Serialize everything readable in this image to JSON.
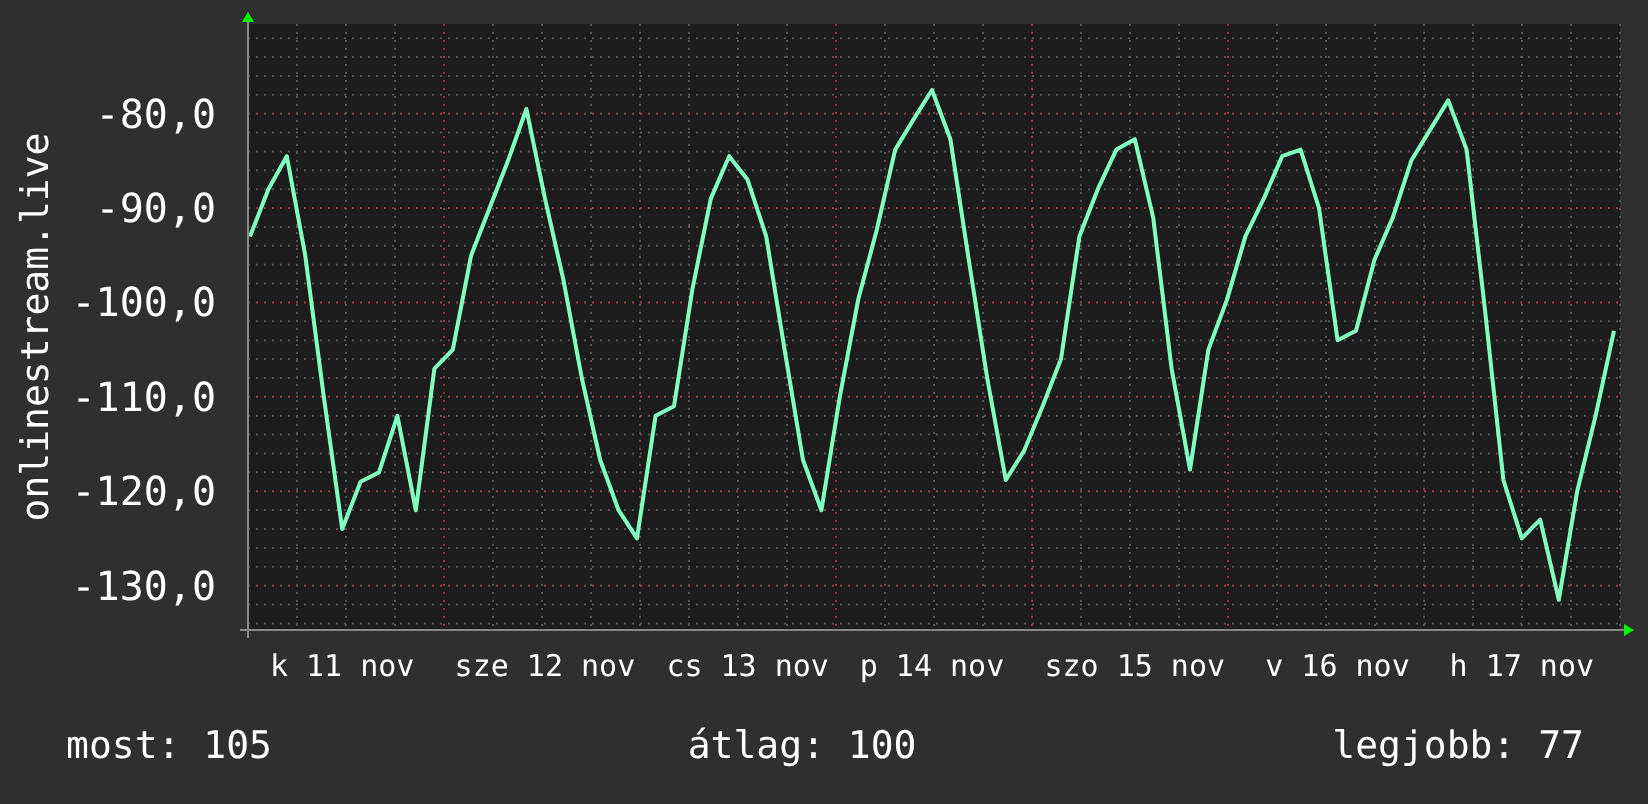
{
  "chart": {
    "chart_data": {
      "type": "line",
      "ylabel": "onlinestream.live",
      "ylim": [
        -134.7,
        -70.5
      ],
      "yticks": [
        {
          "value": -80,
          "label": "-80,0"
        },
        {
          "value": -90,
          "label": "-90,0"
        },
        {
          "value": -100,
          "label": "-100,0"
        },
        {
          "value": -110,
          "label": "-110,0"
        },
        {
          "value": -120,
          "label": "-120,0"
        },
        {
          "value": -130,
          "label": "-130,0"
        }
      ],
      "grid": true,
      "categories": [
        null,
        null,
        null,
        null,
        null,
        "k 11 nov",
        null,
        null,
        null,
        null,
        null,
        null,
        null,
        null,
        null,
        null,
        "sze 12 nov",
        null,
        null,
        null,
        null,
        null,
        null,
        null,
        null,
        null,
        null,
        "cs 13 nov",
        null,
        null,
        null,
        null,
        null,
        null,
        null,
        null,
        null,
        "p 14 nov",
        null,
        null,
        null,
        null,
        null,
        null,
        null,
        null,
        null,
        null,
        "szo 15 nov",
        null,
        null,
        null,
        null,
        null,
        null,
        null,
        null,
        null,
        null,
        "v 16 nov",
        null,
        null,
        null,
        null,
        null,
        null,
        null,
        null,
        null,
        "h 17 nov",
        null,
        null,
        null,
        null,
        null
      ],
      "series": [
        {
          "color": "#80ffc0",
          "values": [
            -93,
            -88,
            -84.5,
            -95,
            -110,
            -124,
            -119,
            -118,
            -112,
            -122,
            -107,
            -105,
            -95,
            -90,
            -85,
            -79.5,
            -89,
            -97.6,
            -108,
            -116.7,
            -122,
            -125,
            -112,
            -111,
            -98.6,
            -89,
            -84.5,
            -87,
            -93,
            -105,
            -116.7,
            -122,
            -110,
            -99.7,
            -92.3,
            -83.8,
            -80.6,
            -77.5,
            -82.7,
            -95.5,
            -108,
            -118.8,
            -115.7,
            -111,
            -106,
            -93,
            -88,
            -83.8,
            -82.7,
            -91,
            -107,
            -117.7,
            -105,
            -99.7,
            -93,
            -89,
            -84.5,
            -83.8,
            -90,
            -104,
            -103,
            -95.5,
            -91,
            -85,
            -81.8,
            -78.6,
            -83.8,
            -100.8,
            -118.8,
            -125,
            -123,
            -131.5,
            -120,
            -112,
            -103
          ]
        }
      ]
    }
  },
  "footer": [
    "most: 105",
    "átlag: 100",
    "legjobb: 77"
  ]
}
